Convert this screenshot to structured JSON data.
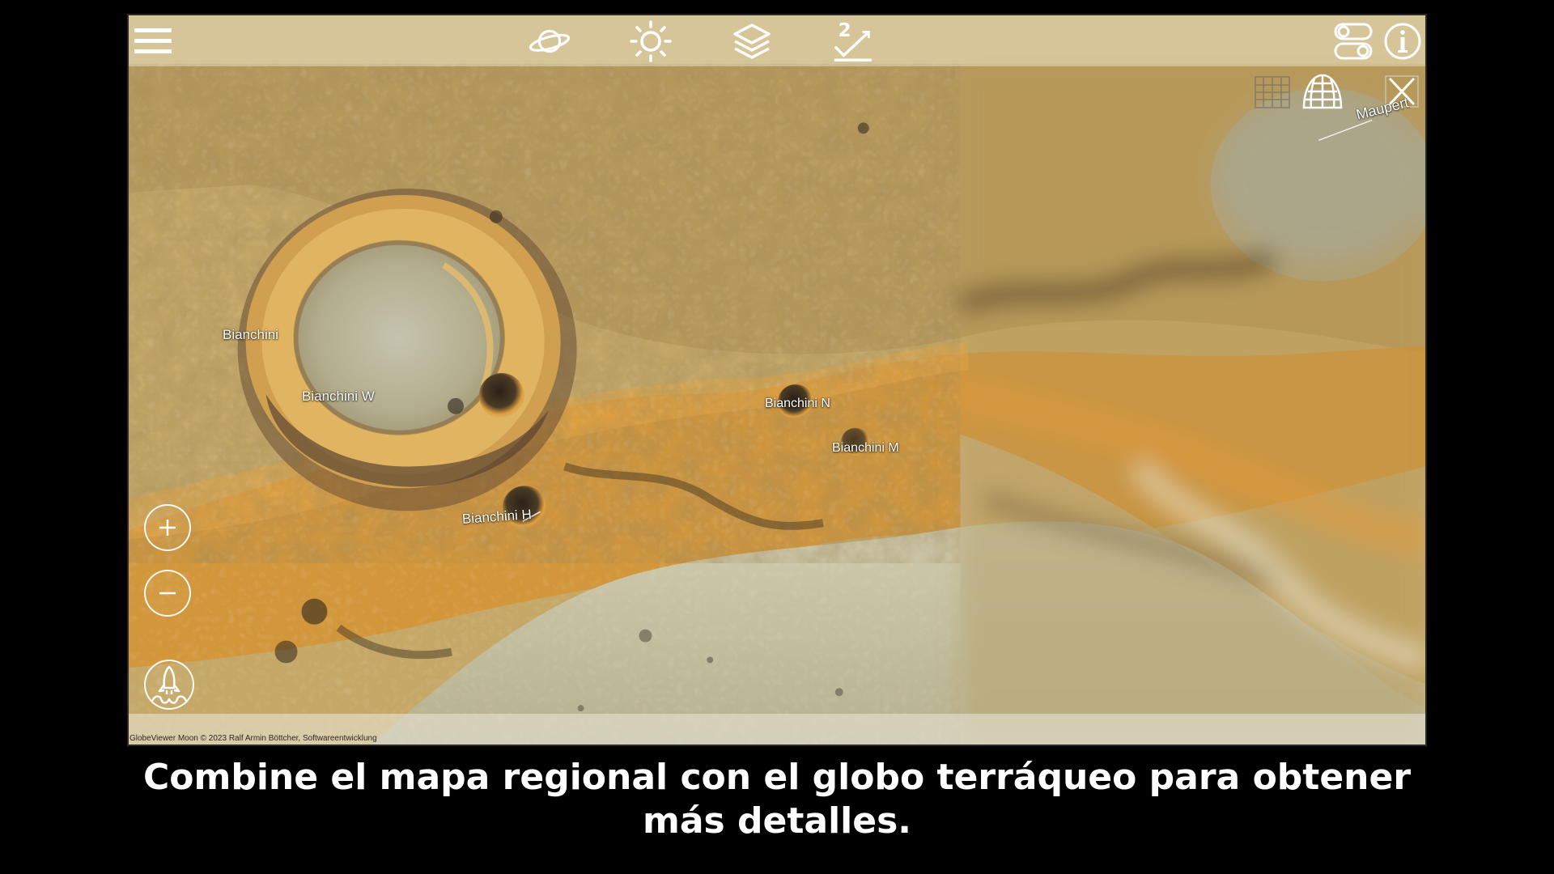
{
  "app": {
    "copyright": "GlobeViewer Moon © 2023 Ralf Armin Böttcher, Softwareentwicklung"
  },
  "toolbar": {
    "items": [
      {
        "name": "menu-icon"
      },
      {
        "name": "planet-icon"
      },
      {
        "name": "sun-icon"
      },
      {
        "name": "layers-icon"
      },
      {
        "name": "measure-icon",
        "badge": "2"
      },
      {
        "name": "settings-toggle-icon"
      },
      {
        "name": "info-icon"
      }
    ]
  },
  "overlay_icons": [
    "grid-icon",
    "globe-grid-icon",
    "close-x-icon"
  ],
  "map": {
    "labels": {
      "bianchini": "Bianchini",
      "bianchini_w": "Bianchini W",
      "bianchini_n": "Bianchini N",
      "bianchini_m": "Bianchini M",
      "bianchini_h": "Bianchini H",
      "maupert": "Maupert"
    }
  },
  "controls": {
    "zoom_in_icon": "plus-icon",
    "zoom_out_icon": "minus-icon",
    "rocket_icon": "rocket-icon"
  },
  "caption": "Combine el mapa regional con el globo terráqueo para obtener más detalles.",
  "colors": {
    "toolbar_bg": "#f0eee1",
    "terrain_orange": "#d6902c",
    "terrain_tan": "#c9b27a",
    "mare_gray": "#b8b59a",
    "caption_text": "#ffffff",
    "page_bg": "#000000"
  }
}
